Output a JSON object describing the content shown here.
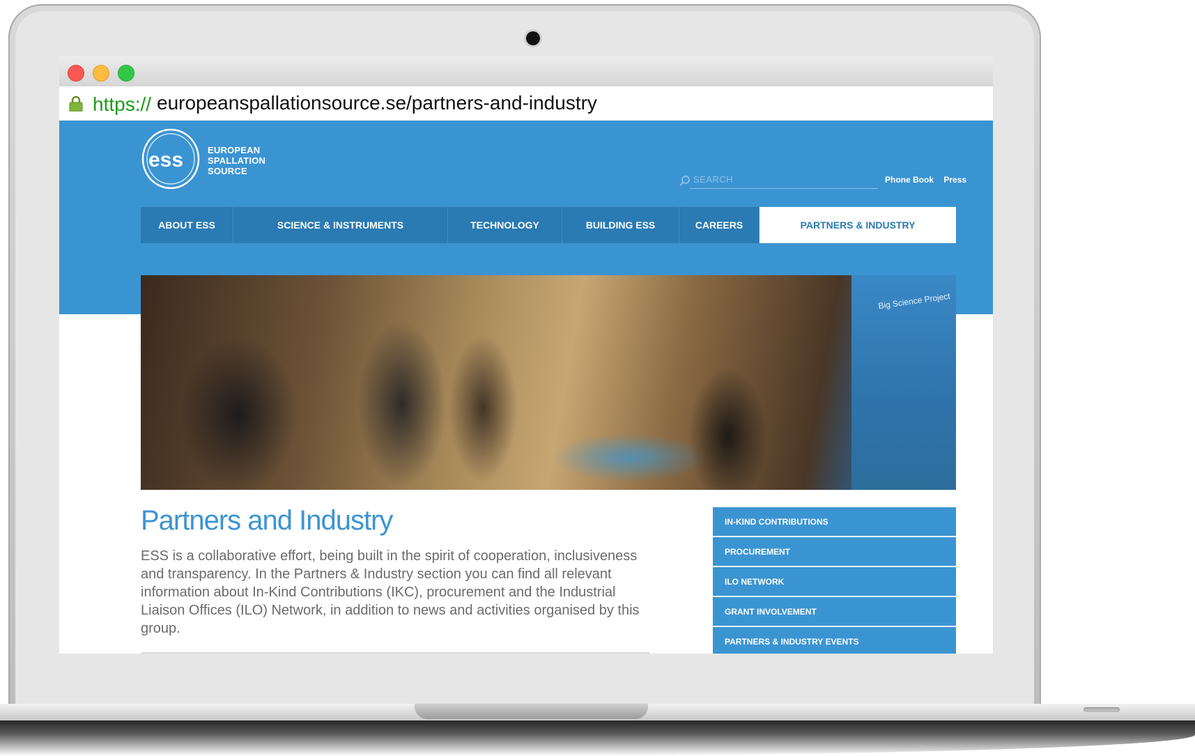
{
  "browser": {
    "url_scheme": "https://",
    "url_rest": "europeanspallationsource.se/partners-and-industry"
  },
  "site": {
    "logo_lines": [
      "EUROPEAN",
      "SPALLATION",
      "SOURCE"
    ],
    "search_placeholder": "SEARCH",
    "util_links": [
      "Phone Book",
      "Press"
    ],
    "nav": [
      {
        "label": "ABOUT ESS",
        "active": false
      },
      {
        "label": "SCIENCE & INSTRUMENTS",
        "active": false
      },
      {
        "label": "TECHNOLOGY",
        "active": false
      },
      {
        "label": "BUILDING ESS",
        "active": false
      },
      {
        "label": "CAREERS",
        "active": false
      },
      {
        "label": "PARTNERS & INDUSTRY",
        "active": true
      }
    ]
  },
  "hero": {
    "banner_text": "Big Science Project"
  },
  "content": {
    "title": "Partners and Industry",
    "intro": "ESS is a collaborative effort, being built in the spirit of cooperation, inclusiveness and transparency. In the Partners & Industry section you can find all relevant information about In-Kind Contributions (IKC), procurement and the Industrial Liaison Offices (ILO) Network, in addition to news and activities organised by this group."
  },
  "side_menu": [
    "IN-KIND CONTRIBUTIONS",
    "PROCUREMENT",
    "ILO NETWORK",
    "GRANT INVOLVEMENT",
    "PARTNERS & INDUSTRY EVENTS"
  ],
  "colors": {
    "brand_blue": "#3b94d2",
    "nav_blue": "#2a7ab3",
    "url_green": "#1d9b1d"
  }
}
